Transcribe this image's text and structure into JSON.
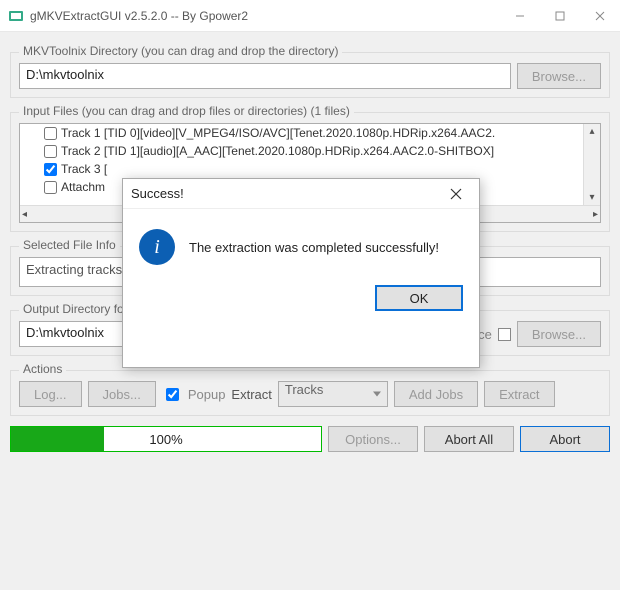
{
  "window": {
    "title": "gMKVExtractGUI v2.5.2.0 -- By Gpower2"
  },
  "mkv_dir": {
    "group_label": "MKVToolnix Directory (you can drag and drop the directory)",
    "value": "D:\\mkvtoolnix",
    "browse": "Browse..."
  },
  "input": {
    "group_label": "Input Files (you can drag and drop files or directories) (1 files)",
    "tracks": [
      {
        "checked": false,
        "label": "Track 1 [TID 0][video][V_MPEG4/ISO/AVC][Tenet.2020.1080p.HDRip.x264.AAC2."
      },
      {
        "checked": false,
        "label": "Track 2 [TID 1][audio][A_AAC][Tenet.2020.1080p.HDRip.x264.AAC2.0-SHITBOX]"
      },
      {
        "checked": true,
        "label": "Track 3 ["
      },
      {
        "checked": false,
        "label": "Attachm"
      }
    ]
  },
  "selected_info": {
    "group_label": "Selected File Info",
    "status_text": "Extracting tracks"
  },
  "output": {
    "group_label": "Output Directory for Selected File (you can drag and drop the directory)",
    "value": "D:\\mkvtoolnix",
    "use_source": "Use Source",
    "browse": "Browse..."
  },
  "actions": {
    "group_label": "Actions",
    "log": "Log...",
    "jobs": "Jobs...",
    "popup": "Popup",
    "extract_label": "Extract",
    "combo_value": "Tracks",
    "add_jobs": "Add Jobs",
    "extract_btn": "Extract"
  },
  "bottom": {
    "progress_text": "100%",
    "options": "Options...",
    "abort_all": "Abort All",
    "abort": "Abort"
  },
  "dialog": {
    "title": "Success!",
    "message": "The extraction was completed successfully!",
    "ok": "OK"
  }
}
